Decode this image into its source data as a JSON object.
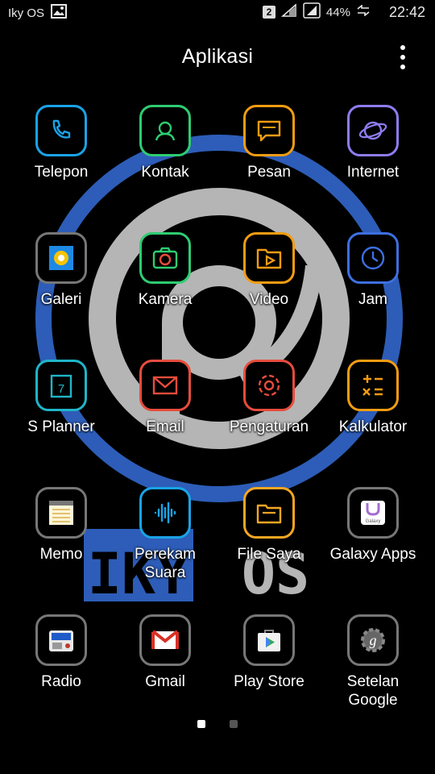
{
  "statusbar": {
    "carrier": "Iky OS",
    "sim_slot": "2",
    "battery": "44%",
    "time": "22:42"
  },
  "header": {
    "title": "Aplikasi"
  },
  "wallpaper": {
    "logo_text_left": "IKY",
    "logo_text_right": "OS"
  },
  "apps": [
    {
      "label": "Telepon",
      "icon": "phone-icon",
      "color": "#1aa3e8"
    },
    {
      "label": "Kontak",
      "icon": "contacts-icon",
      "color": "#2ecc71"
    },
    {
      "label": "Pesan",
      "icon": "message-icon",
      "color": "#f39c12"
    },
    {
      "label": "Internet",
      "icon": "internet-icon",
      "color": "#8e7cf0"
    },
    {
      "label": "Galeri",
      "icon": "gallery-icon",
      "color": "#f5c400"
    },
    {
      "label": "Kamera",
      "icon": "camera-icon",
      "color": "#2ecc71"
    },
    {
      "label": "Video",
      "icon": "video-icon",
      "color": "#f39c12"
    },
    {
      "label": "Jam",
      "icon": "clock-icon",
      "color": "#3d6fe0"
    },
    {
      "label": "S Planner",
      "icon": "calendar-icon",
      "color": "#1fb5c9"
    },
    {
      "label": "Email",
      "icon": "email-icon",
      "color": "#e74c3c"
    },
    {
      "label": "Pengaturan",
      "icon": "settings-icon",
      "color": "#e74c3c"
    },
    {
      "label": "Kalkulator",
      "icon": "calculator-icon",
      "color": "#f39c12"
    },
    {
      "label": "Memo",
      "icon": "memo-icon",
      "color": "#f7d56b"
    },
    {
      "label": "Perekam Suara",
      "icon": "voice-recorder-icon",
      "color": "#1aa3e8"
    },
    {
      "label": "File Saya",
      "icon": "folder-icon",
      "color": "#f5a623"
    },
    {
      "label": "Galaxy Apps",
      "icon": "galaxy-apps-icon",
      "color": "#a56cd0"
    },
    {
      "label": "Radio",
      "icon": "radio-icon",
      "color": "#1e5ac8"
    },
    {
      "label": "Gmail",
      "icon": "gmail-icon",
      "color": "#d93025"
    },
    {
      "label": "Play Store",
      "icon": "play-store-icon",
      "color": "#34a853"
    },
    {
      "label": "Setelan Google",
      "icon": "google-settings-icon",
      "color": "#4285f4"
    }
  ],
  "pager": {
    "pages": 2,
    "active_page": 1
  }
}
